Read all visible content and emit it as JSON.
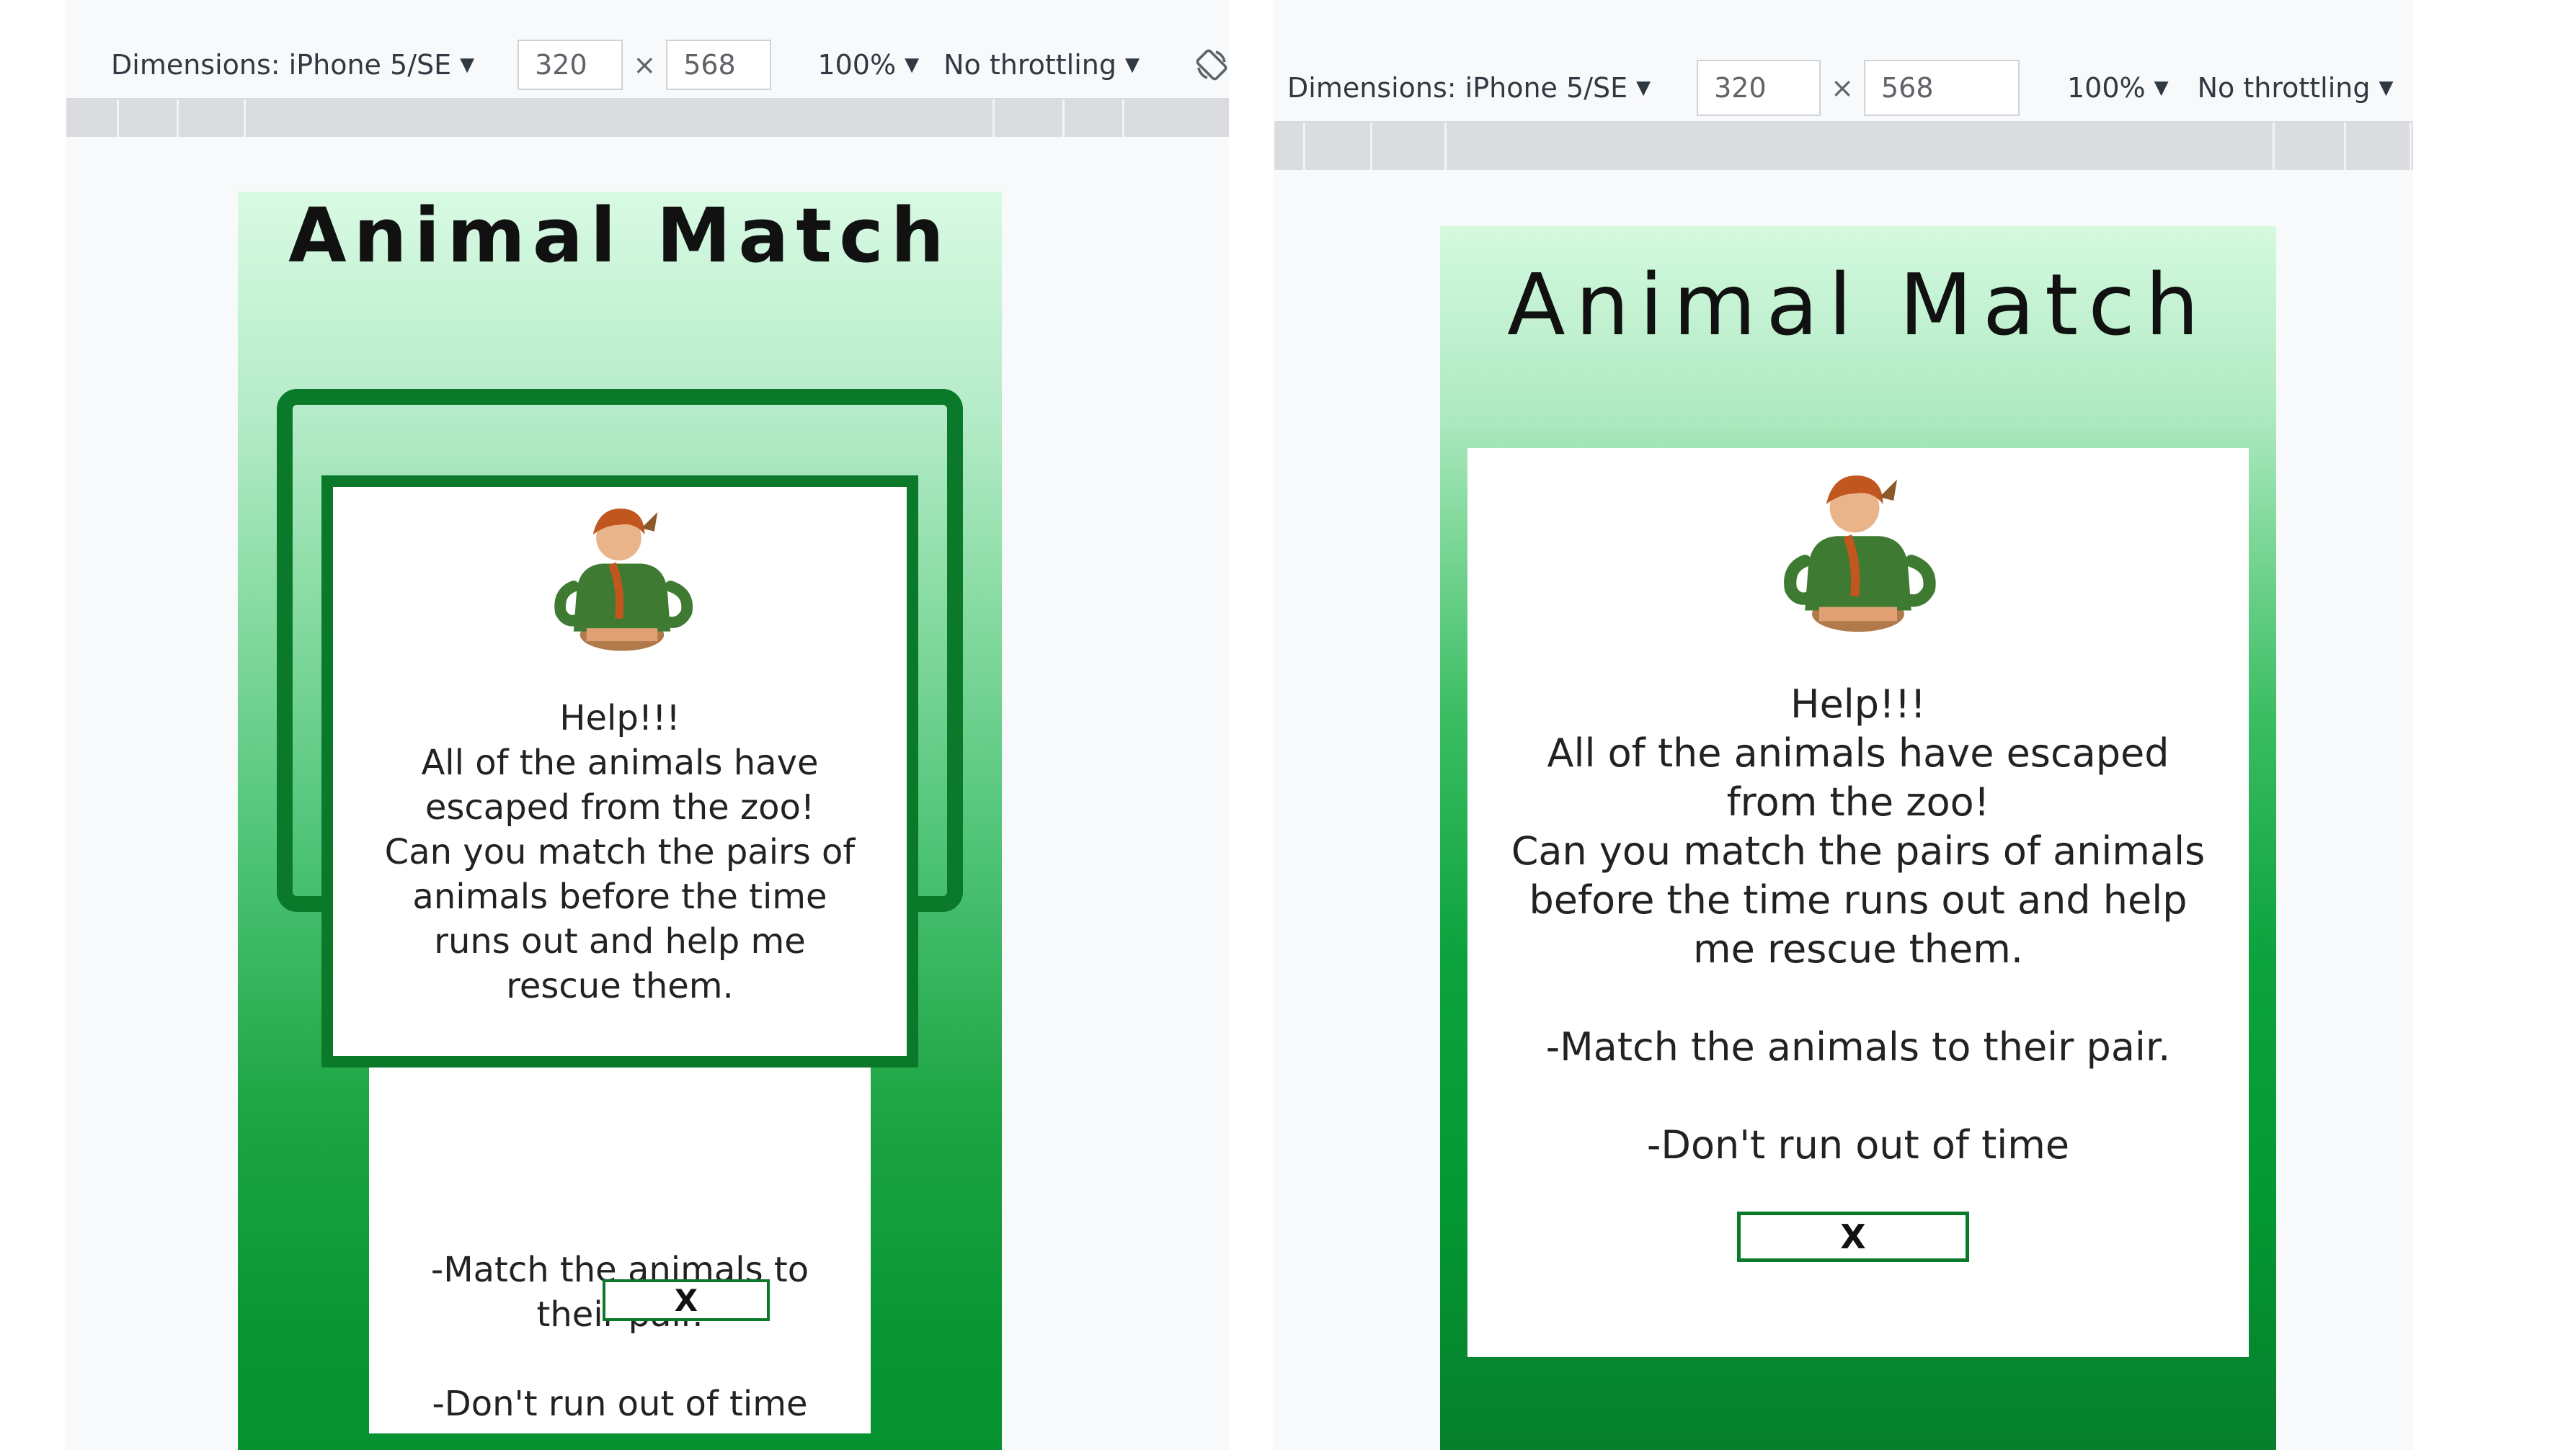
{
  "left": {
    "toolbar": {
      "dimensions_label": "Dimensions: iPhone 5/SE",
      "width_value": "320",
      "times": "×",
      "height_value": "568",
      "zoom": "100%",
      "throttling": "No throttling"
    },
    "app": {
      "title": "Animal Match",
      "message_lines": [
        "Help!!!",
        "All of the animals have",
        "escaped from the zoo!",
        "Can you match the pairs of",
        "animals before the time",
        "runs out and help me",
        "rescue them."
      ],
      "rule_lines": [
        "-Match the animals to",
        "their pair.",
        "",
        "-Don't run out of time"
      ],
      "close_label": "X"
    }
  },
  "right": {
    "toolbar": {
      "dimensions_label": "Dimensions: iPhone 5/SE",
      "width_value": "320",
      "times": "×",
      "height_value": "568",
      "zoom": "100%",
      "throttling": "No throttling"
    },
    "app": {
      "title": "Animal Match",
      "message_lines": [
        "Help!!!",
        "All of the animals have escaped",
        "from the zoo!",
        "Can you match the pairs of animals",
        "before the time runs out and help",
        "me rescue them.",
        "",
        "-Match the animals to their pair.",
        "",
        "-Don't run out of time"
      ],
      "close_label": "X"
    }
  },
  "colors": {
    "frame_green": "#0a7a2a",
    "toolbar_bg": "#f8f9fa",
    "ruler_bg": "#dadce0"
  },
  "icons": [
    "caret-down-icon",
    "rotate-icon",
    "zookeeper-illustration"
  ]
}
